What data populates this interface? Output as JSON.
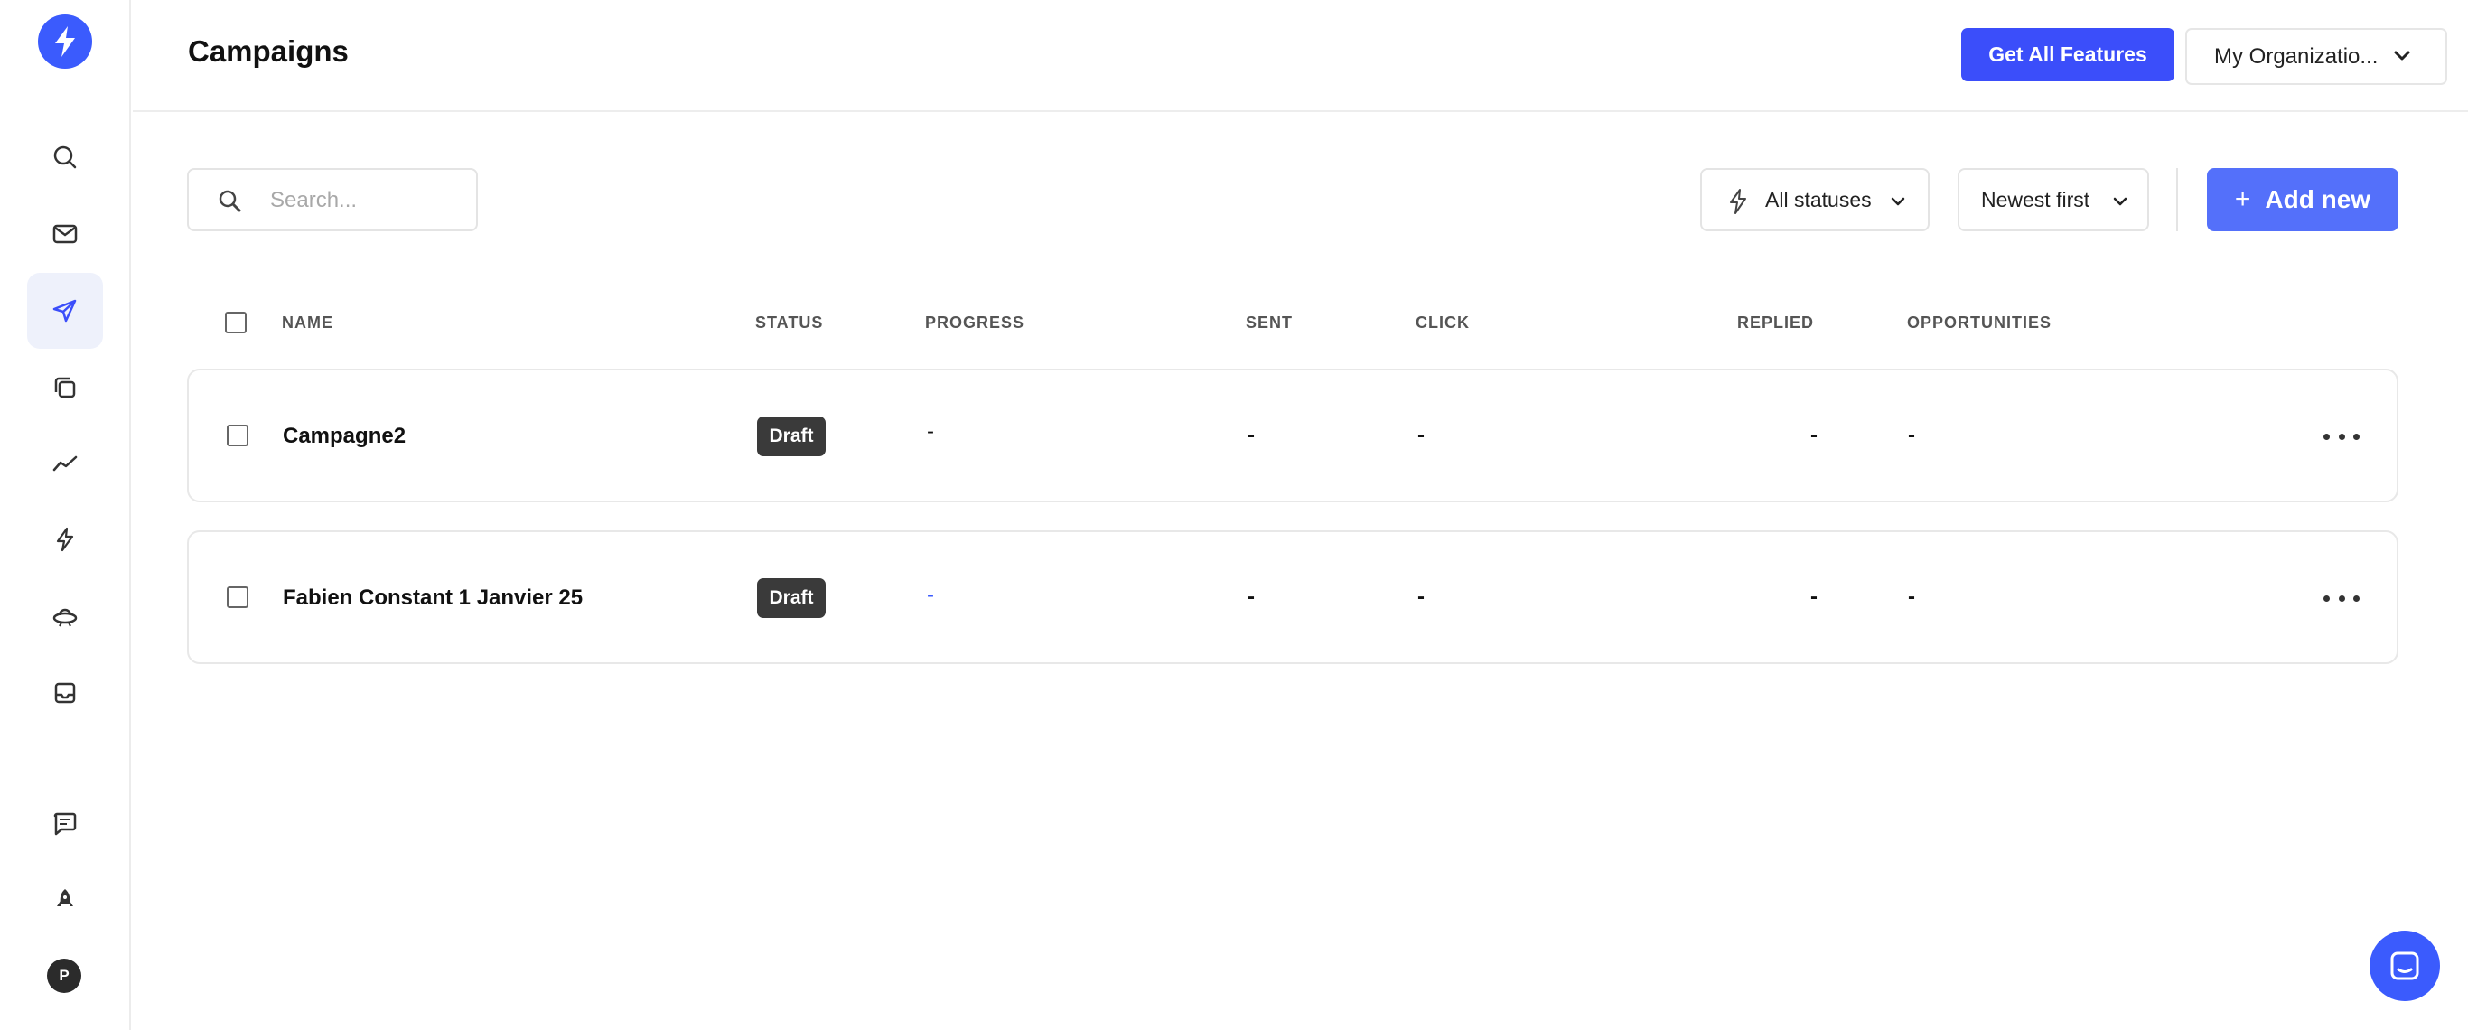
{
  "header": {
    "title": "Campaigns",
    "features_button": "Get All Features",
    "org_selector": "My Organizatio..."
  },
  "toolbar": {
    "search_placeholder": "Search...",
    "status_filter": "All statuses",
    "sort": "Newest first",
    "add_button": "Add new"
  },
  "table": {
    "columns": [
      "NAME",
      "STATUS",
      "PROGRESS",
      "SENT",
      "CLICK",
      "REPLIED",
      "OPPORTUNITIES"
    ],
    "rows": [
      {
        "name": "Campagne2",
        "status": "Draft",
        "progress": "-",
        "sent": "-",
        "click": "-",
        "replied": "-",
        "opportunities": "-"
      },
      {
        "name": "Fabien Constant 1 Janvier 25",
        "status": "Draft",
        "progress": "-",
        "sent": "-",
        "click": "-",
        "replied": "-",
        "opportunities": "-"
      }
    ]
  },
  "sidebar": {
    "items": [
      "search-icon",
      "mail-icon",
      "send-icon",
      "copy-icon",
      "analytics-icon",
      "bolt-icon",
      "ufo-icon",
      "inbox-icon",
      "feedback-icon",
      "rocket-icon"
    ],
    "active_item": "send-icon",
    "avatar_initial": "P"
  },
  "colors": {
    "brand": "#3b5bfd",
    "primary_button": "#3b4efa",
    "add_button": "#5470fa",
    "draft_badge": "#3a3a3a",
    "active_nav_bg": "#eef1fb"
  }
}
